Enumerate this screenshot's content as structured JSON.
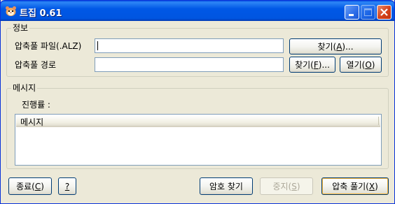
{
  "window": {
    "title": "트집 0.61",
    "icon": "hamster-icon",
    "controls": {
      "minimize": "minimize-icon",
      "maximize": "maximize-icon",
      "close": "close-icon"
    }
  },
  "info_group": {
    "legend": "정보",
    "archive_file_label": "압축풀 파일(.ALZ)",
    "archive_file_value": "",
    "extract_path_label": "압축풀 경로",
    "extract_path_value": "",
    "browse_file_button": {
      "text": "찾기(",
      "accel": "A",
      "after": ")..."
    },
    "browse_path_button": {
      "text": "찾기(",
      "accel": "F",
      "after": ")..."
    },
    "open_button": {
      "text": "열기(",
      "accel": "O",
      "after": ")"
    }
  },
  "message_group": {
    "legend": "메시지",
    "progress_label": "진행률 :",
    "list_header": "메시지"
  },
  "footer": {
    "exit_button": {
      "text": "종료(",
      "accel": "C",
      "after": ")"
    },
    "help_button": {
      "accel": "?"
    },
    "find_password_button": "암호 찾기",
    "stop_button": {
      "text": "중지(",
      "accel": "S",
      "after": ")"
    },
    "extract_button": {
      "text": "압축 풀기(",
      "accel": "X",
      "after": ")"
    }
  }
}
